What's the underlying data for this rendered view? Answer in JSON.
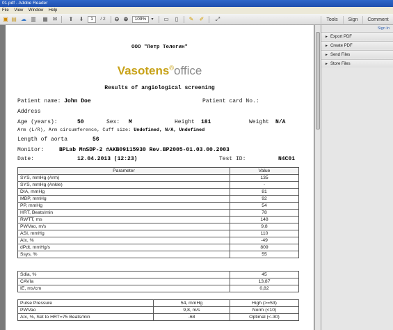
{
  "window": {
    "title": "01.pdf - Adobe Reader"
  },
  "menu": [
    "File",
    "View",
    "Window",
    "Help"
  ],
  "toolbar": {
    "page_current": "1",
    "page_total": "/ 2",
    "zoom": "109%",
    "tabs": [
      "Tools",
      "Sign",
      "Comment"
    ]
  },
  "right_panel": {
    "sign_in": "Sign In",
    "items": [
      "Export PDF",
      "Create PDF",
      "Send Files",
      "Store Files"
    ]
  },
  "document": {
    "org": "ООО \"Петр Телегин\"",
    "logo_brand": "Vasotens",
    "logo_dot": "®",
    "logo_suffix": "office",
    "title": "Results of angiological screening",
    "patient_name_label": "Patient name:",
    "patient_name": "John Doe",
    "card_label": "Patient card No.:",
    "address_label": "Address",
    "age_label": "Age (years):",
    "age": "50",
    "sex_label": "Sex:",
    "sex": "M",
    "height_label": "Height",
    "height": "181",
    "weight_label": "Weight",
    "weight": "N/A",
    "arm_label": "Arm (L/R), Arm circumference, Cuff size:",
    "arm_value": "Undefined, N/A, Undefined",
    "aorta_label": "Length of aorta",
    "aorta": "56",
    "monitor_label": "Monitor:",
    "monitor": "BPLab MnSDP-2 #AKB09115930 Rev.BP2005-01.03.00.2003",
    "date_label": "Date:",
    "date": "12.04.2013 (12:23)",
    "test_id_label": "Test ID:",
    "test_id": "N4C01",
    "table_headers": [
      "Parameter",
      "Value"
    ],
    "params": [
      [
        "SYS, mmHg (Arm)",
        "135"
      ],
      [
        "SYS, mmHg (Ankle)",
        "-"
      ],
      [
        "DIA, mmHg",
        "81"
      ],
      [
        "MBP, mmHg",
        "92"
      ],
      [
        "PP, mmHg",
        "54"
      ],
      [
        "HRT, Beats/min",
        "78"
      ],
      [
        "RWTT, ms",
        "148"
      ],
      [
        "PWVao, m/s",
        "9,8"
      ],
      [
        "ASI, mmHg",
        "110"
      ],
      [
        "AIx, %",
        "-49"
      ],
      [
        "dPdt, mmHg/s",
        "809"
      ],
      [
        "Ssys, %",
        "55"
      ]
    ],
    "params2": [
      [
        "Sdia, %",
        "45"
      ],
      [
        "CAVIa",
        "13,87"
      ],
      [
        "IE, ms/cm",
        "0,82"
      ]
    ],
    "summary": [
      [
        "Pulse Pressure",
        "54, mmHg",
        "High (>=53)"
      ],
      [
        "PWVao",
        "9,8, m/s",
        "Norm (<10)"
      ],
      [
        "AIx, %, Set to HRT=75 Beats/min",
        "-68",
        "Optimal (<-30)"
      ]
    ]
  }
}
